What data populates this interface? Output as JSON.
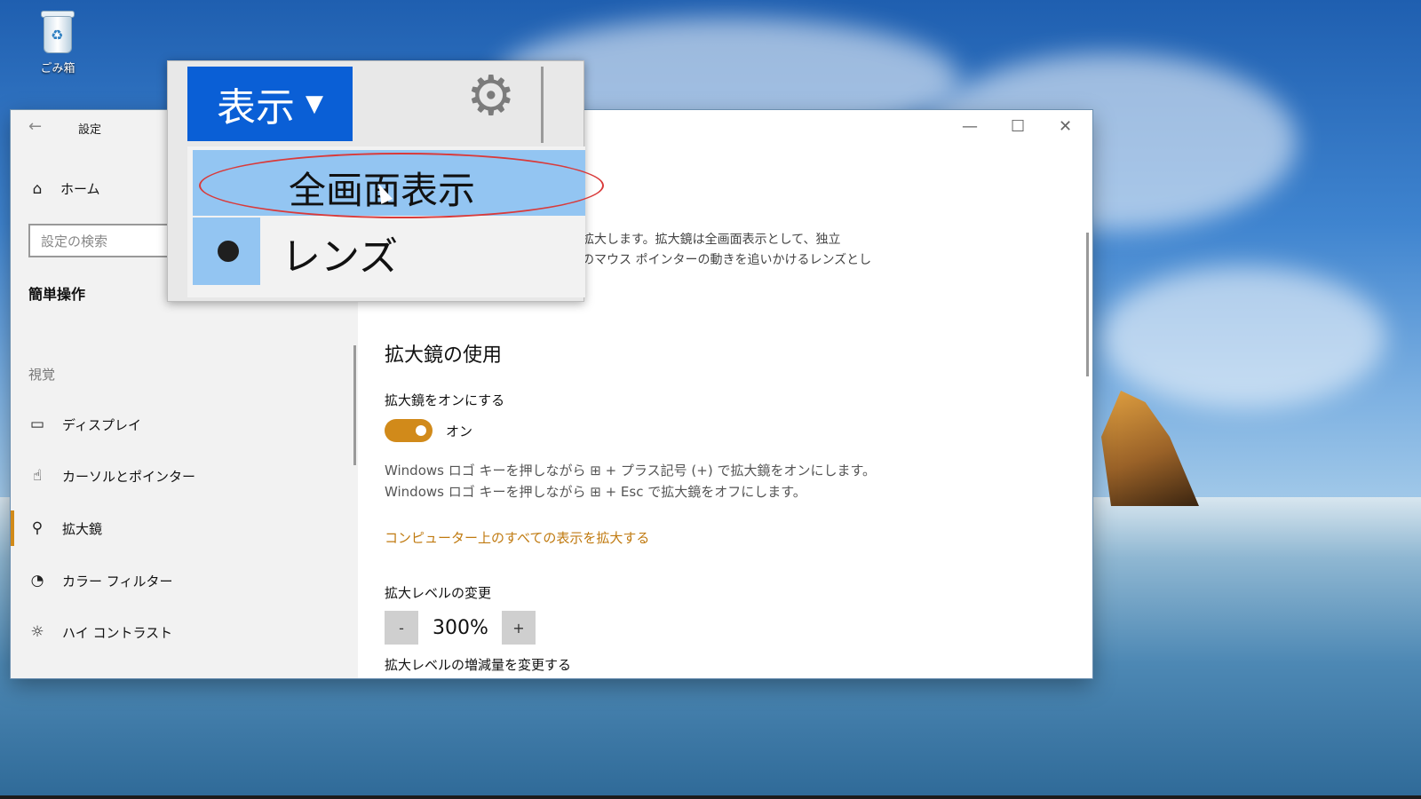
{
  "desktop": {
    "recycle_bin_label": "ごみ箱"
  },
  "settings": {
    "title": "設定",
    "home_label": "ホーム",
    "search_placeholder": "設定の検索",
    "section_title": "簡単操作",
    "group_label": "視覚",
    "nav_items": [
      {
        "icon": "monitor-icon",
        "label": "ディスプレイ"
      },
      {
        "icon": "cursor-icon",
        "label": "カーソルとポインター"
      },
      {
        "icon": "magnifier-icon",
        "label": "拡大鏡"
      },
      {
        "icon": "color-filter-icon",
        "label": "カラー フィルター"
      },
      {
        "icon": "brightness-icon",
        "label": "ハイ コントラスト"
      }
    ],
    "active_nav": "拡大鏡"
  },
  "main": {
    "description_line1": "拡大します。拡大鏡は全画面表示として、独立",
    "description_line2": "のマウス ポインターの動きを追いかけるレンズとし",
    "heading": "拡大鏡の使用",
    "toggle_label": "拡大鏡をオンにする",
    "toggle_state": "オン",
    "hint_line1": "Windows ロゴ キーを押しながら ⊞ + プラス記号 (+) で拡大鏡をオンにします。",
    "hint_line2": "Windows ロゴ キーを押しながら ⊞ + Esc で拡大鏡をオフにします。",
    "link_text": "コンピューター上のすべての表示を拡大する",
    "zoom_label": "拡大レベルの変更",
    "zoom_minus": "-",
    "zoom_value": "300%",
    "zoom_plus": "+",
    "zoom_increment_label": "拡大レベルの増減量を変更する"
  },
  "magnifier_popup": {
    "view_button_label": "表示",
    "menu_options": [
      "全画面表示",
      "レンズ"
    ],
    "selected_option": "レンズ",
    "highlighted_option": "全画面表示"
  },
  "colors": {
    "accent": "#d18a1a",
    "popup_button": "#0a5fd6",
    "menu_highlight": "#93c5f2",
    "annotation": "#d93a3a"
  }
}
